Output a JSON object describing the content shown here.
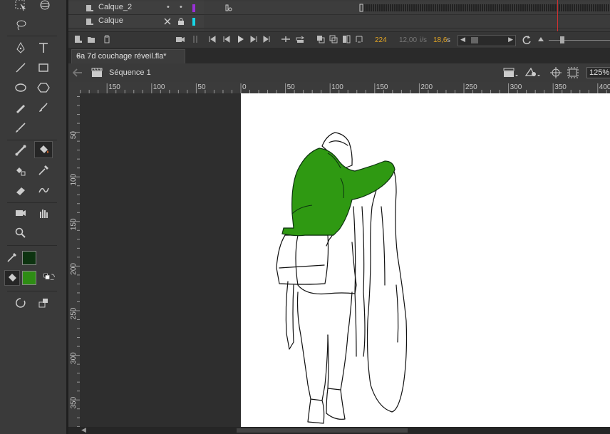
{
  "timeline": {
    "layers": [
      {
        "name": "Calque_2",
        "color": "#9b30d8"
      },
      {
        "name": "Calque",
        "color": "#17d6e6"
      }
    ],
    "controls": {
      "frame": "224",
      "fps": "12,00",
      "fps_unit": "i/s",
      "time": "18,6",
      "time_unit": "s"
    }
  },
  "document": {
    "tab_label": "6a 7d couchage réveil.fla*",
    "close_glyph": "×"
  },
  "editbar": {
    "scene": "Séquence 1",
    "zoom": "125%"
  },
  "ruler": {
    "h_labels": [
      "150",
      "100",
      "50",
      "0",
      "50",
      "100",
      "150",
      "200",
      "250",
      "300",
      "350",
      "400"
    ],
    "v_labels": [
      "50",
      "100",
      "150",
      "200",
      "250",
      "300",
      "350"
    ]
  },
  "colors": {
    "stroke_swatch": "#0d3310",
    "fill_swatch": "#2e8c14",
    "jacket": "#2f9912",
    "playhead": "#d23030"
  },
  "tools": {
    "icons": [
      "selection-icon",
      "3d-rotation-icon",
      "lasso-icon",
      "pen-icon",
      "text-icon",
      "line-icon",
      "rectangle-icon",
      "oval-icon",
      "polystar-icon",
      "pencil-icon",
      "brush-icon",
      "paint-brush-icon",
      "bone-icon",
      "paint-bucket-icon",
      "ink-bottle-icon",
      "eyedropper-icon",
      "eraser-icon",
      "width-icon",
      "camera-icon",
      "hand-icon",
      "zoom-icon"
    ]
  }
}
